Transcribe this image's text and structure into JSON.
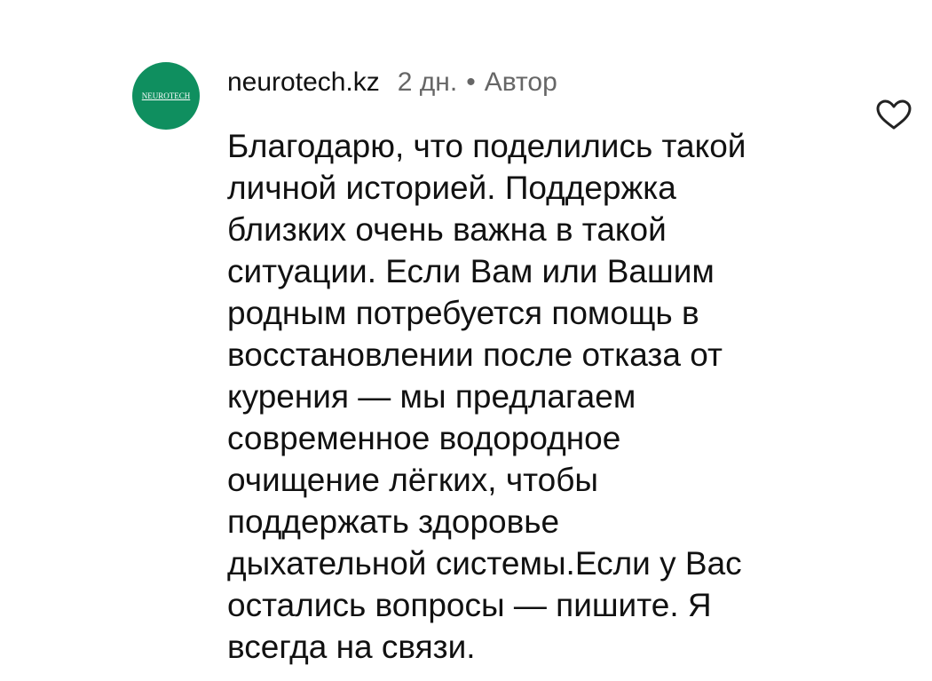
{
  "comment": {
    "avatar": {
      "logo_text": "NEUROTECH",
      "color": "#0f8f5f"
    },
    "username": "neurotech.kz",
    "time_ago": "2 дн.",
    "separator": "•",
    "author_badge": "Автор",
    "text": "Благодарю, что поделились такой\nличной историей. Поддержка\nблизких очень важна в такой\nситуации. Если Вам или Вашим\nродным потребуется помощь в\nвосстановлении после отказа от\nкурения — мы предлагаем\nсовременное водородное\nочищение лёгких, чтобы\nподдержать здоровье\nдыхательной системы.Если у Вас\nостались вопросы — пишите. Я\nвсегда на связи.",
    "like_icon": "heart-outline-icon"
  }
}
